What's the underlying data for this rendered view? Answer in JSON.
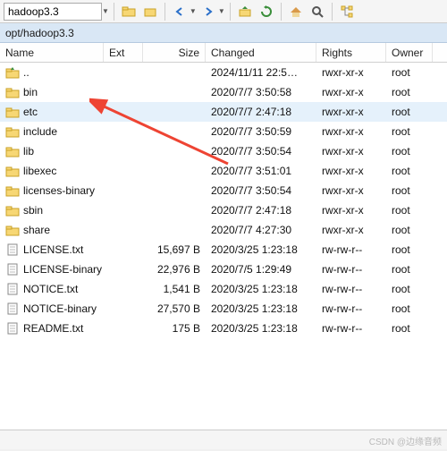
{
  "toolbar": {
    "breadcrumb_value": "hadoop3.3",
    "icons": [
      "folder-open-icon",
      "folder-icon",
      "arrow-left-icon",
      "arrow-right-icon",
      "folder-up-icon",
      "refresh-icon",
      "home-icon",
      "find-icon",
      "tree-icon"
    ]
  },
  "pathbar": {
    "text": "opt/hadoop3.3"
  },
  "columns": {
    "name": "Name",
    "ext": "Ext",
    "size": "Size",
    "changed": "Changed",
    "rights": "Rights",
    "owner": "Owner"
  },
  "rows": [
    {
      "icon": "folder-up",
      "name": "..",
      "size": "",
      "changed": "2024/11/11 22:5…",
      "rights": "rwxr-xr-x",
      "owner": "root",
      "selected": false
    },
    {
      "icon": "folder",
      "name": "bin",
      "size": "",
      "changed": "2020/7/7 3:50:58",
      "rights": "rwxr-xr-x",
      "owner": "root",
      "selected": false
    },
    {
      "icon": "folder",
      "name": "etc",
      "size": "",
      "changed": "2020/7/7 2:47:18",
      "rights": "rwxr-xr-x",
      "owner": "root",
      "selected": true
    },
    {
      "icon": "folder",
      "name": "include",
      "size": "",
      "changed": "2020/7/7 3:50:59",
      "rights": "rwxr-xr-x",
      "owner": "root",
      "selected": false
    },
    {
      "icon": "folder",
      "name": "lib",
      "size": "",
      "changed": "2020/7/7 3:50:54",
      "rights": "rwxr-xr-x",
      "owner": "root",
      "selected": false
    },
    {
      "icon": "folder",
      "name": "libexec",
      "size": "",
      "changed": "2020/7/7 3:51:01",
      "rights": "rwxr-xr-x",
      "owner": "root",
      "selected": false
    },
    {
      "icon": "folder",
      "name": "licenses-binary",
      "size": "",
      "changed": "2020/7/7 3:50:54",
      "rights": "rwxr-xr-x",
      "owner": "root",
      "selected": false
    },
    {
      "icon": "folder",
      "name": "sbin",
      "size": "",
      "changed": "2020/7/7 2:47:18",
      "rights": "rwxr-xr-x",
      "owner": "root",
      "selected": false
    },
    {
      "icon": "folder",
      "name": "share",
      "size": "",
      "changed": "2020/7/7 4:27:30",
      "rights": "rwxr-xr-x",
      "owner": "root",
      "selected": false
    },
    {
      "icon": "file",
      "name": "LICENSE.txt",
      "size": "15,697 B",
      "changed": "2020/3/25 1:23:18",
      "rights": "rw-rw-r--",
      "owner": "root",
      "selected": false
    },
    {
      "icon": "file",
      "name": "LICENSE-binary",
      "size": "22,976 B",
      "changed": "2020/7/5 1:29:49",
      "rights": "rw-rw-r--",
      "owner": "root",
      "selected": false
    },
    {
      "icon": "file",
      "name": "NOTICE.txt",
      "size": "1,541 B",
      "changed": "2020/3/25 1:23:18",
      "rights": "rw-rw-r--",
      "owner": "root",
      "selected": false
    },
    {
      "icon": "file",
      "name": "NOTICE-binary",
      "size": "27,570 B",
      "changed": "2020/3/25 1:23:18",
      "rights": "rw-rw-r--",
      "owner": "root",
      "selected": false
    },
    {
      "icon": "file",
      "name": "README.txt",
      "size": "175 B",
      "changed": "2020/3/25 1:23:18",
      "rights": "rw-rw-r--",
      "owner": "root",
      "selected": false
    }
  ],
  "watermark": "CSDN @边缘音频"
}
